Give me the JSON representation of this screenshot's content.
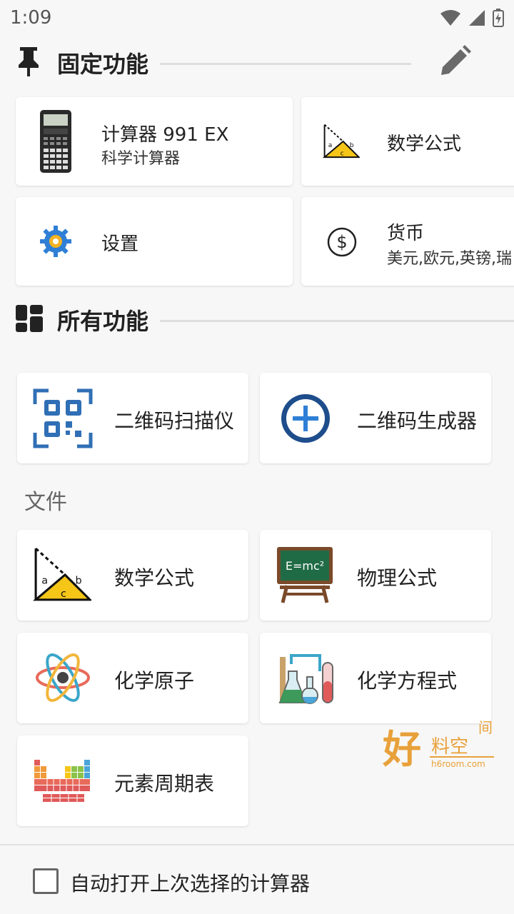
{
  "status_bar": {
    "time": "1:09"
  },
  "pinned": {
    "title": "固定功能",
    "cards": [
      {
        "title": "计算器 991 EX",
        "subtitle": "科学计算器",
        "icon": "calculator-icon"
      },
      {
        "title": "数学公式",
        "icon": "triangle-formula-icon"
      },
      {
        "title": "设置",
        "icon": "gear-icon"
      },
      {
        "title": "货币",
        "subtitle": "美元,欧元,英镑,瑞",
        "icon": "dollar-icon"
      }
    ]
  },
  "all_functions": {
    "title": "所有功能",
    "qr_cards": [
      {
        "title": "二维码扫描仪",
        "icon": "qr-scan-icon"
      },
      {
        "title": "二维码生成器",
        "icon": "plus-circle-icon"
      }
    ],
    "files_label": "文件",
    "file_cards": [
      {
        "title": "数学公式",
        "icon": "triangle-formula-icon"
      },
      {
        "title": "物理公式",
        "icon": "blackboard-icon",
        "board_text": "E=mc²"
      },
      {
        "title": "化学原子",
        "icon": "atom-icon"
      },
      {
        "title": "化学方程式",
        "icon": "lab-flask-icon"
      },
      {
        "title": "元素周期表",
        "icon": "periodic-table-icon"
      }
    ]
  },
  "watermark": {
    "text_main": "好",
    "text_side": "料空",
    "text_top": "间",
    "url": "h6room.com"
  },
  "bottom": {
    "auto_open_label": "自动打开上次选择的计算器",
    "checked": false
  },
  "colors": {
    "accent_blue": "#1e4d8c",
    "triangle_yellow": "#f5c518",
    "board_green": "#1f6b45",
    "watermark_orange": "#e8a13a"
  }
}
